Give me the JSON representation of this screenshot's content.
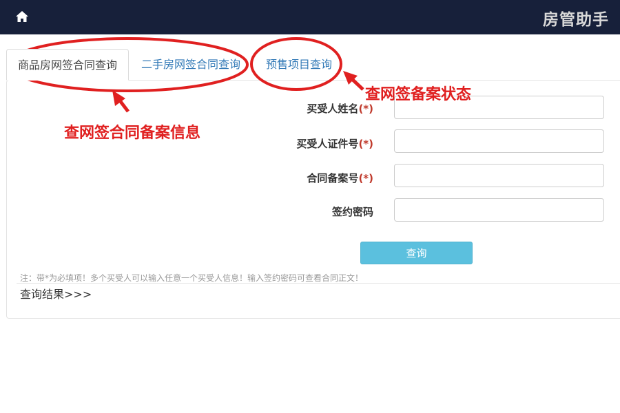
{
  "header": {
    "app_title": "房管助手",
    "home_icon": "home-icon"
  },
  "tabs": [
    {
      "label": "商品房网签合同查询",
      "active": true
    },
    {
      "label": "二手房网签合同查询",
      "active": false
    },
    {
      "label": "预售项目查询",
      "active": false
    }
  ],
  "form": {
    "fields": [
      {
        "label": "买受人姓名",
        "required_mark": "(*)",
        "value": ""
      },
      {
        "label": "买受人证件号",
        "required_mark": "(*)",
        "value": ""
      },
      {
        "label": "合同备案号",
        "required_mark": "(*)",
        "value": ""
      },
      {
        "label": "签约密码",
        "required_mark": "",
        "value": ""
      }
    ],
    "submit_label": "查询"
  },
  "note": "注：带*为必填项！多个买受人可以输入任意一个买受人信息！输入签约密码可查看合同正文！",
  "result_label": "查询结果>>>",
  "annotations": {
    "left_caption": "查网签合同备案信息",
    "right_caption": "查网签备案状态"
  },
  "colors": {
    "header_bg": "#17203a",
    "accent_button": "#5bc0de",
    "annotation_red": "#e02020",
    "link_blue": "#337ab7"
  }
}
